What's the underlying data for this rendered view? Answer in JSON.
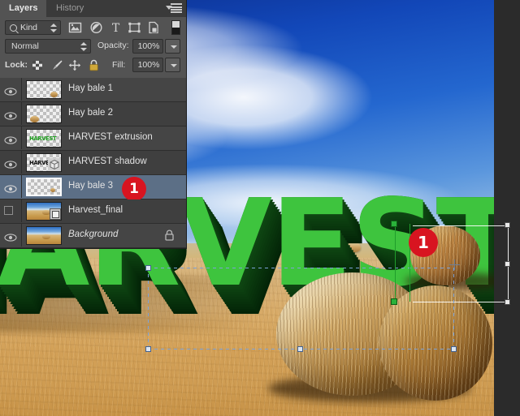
{
  "app": {
    "name": "Adobe Photoshop",
    "accent_red": "#d81420",
    "panel_bg": "#535353",
    "selected_row_bg": "#5c6f86",
    "text_green": "#3ec43e",
    "extrusion_green": "#0c3d10"
  },
  "panel": {
    "tabs": [
      {
        "label": "Layers",
        "active": true
      },
      {
        "label": "History",
        "active": false
      }
    ],
    "menu_icon": "panel-menu-icon",
    "filter": {
      "kind_label": "Kind",
      "search_icon": "search-icon",
      "icons": [
        {
          "name": "pixel-layer-filter-icon",
          "title": "Pixel layers"
        },
        {
          "name": "adjustment-layer-filter-icon",
          "title": "Adjustment layers"
        },
        {
          "name": "type-layer-filter-icon",
          "title": "Type layers"
        },
        {
          "name": "shape-layer-filter-icon",
          "title": "Shape layers"
        },
        {
          "name": "smart-object-filter-icon",
          "title": "Smart objects"
        }
      ],
      "toggle_icon": "filter-toggle-swatch"
    },
    "blend": {
      "mode": "Normal",
      "opacity_label": "Opacity:",
      "opacity_value": "100%",
      "opacity_dropdown_icon": "chevron-down-icon"
    },
    "lock": {
      "label": "Lock:",
      "icons": [
        {
          "name": "lock-transparency-icon",
          "title": "Lock transparent pixels"
        },
        {
          "name": "lock-image-pixels-icon",
          "title": "Lock image pixels"
        },
        {
          "name": "lock-position-icon",
          "title": "Lock position"
        },
        {
          "name": "lock-all-icon",
          "title": "Lock all"
        }
      ],
      "fill_label": "Fill:",
      "fill_value": "100%",
      "fill_dropdown_icon": "chevron-down-icon"
    },
    "layers": [
      {
        "name": "Hay bale 1",
        "visible": true,
        "selected": false,
        "italic": false,
        "locked": false,
        "thumb": "transparent-bale-small"
      },
      {
        "name": "Hay bale 2",
        "visible": true,
        "selected": false,
        "italic": false,
        "locked": false,
        "thumb": "transparent-bale-left"
      },
      {
        "name": "HARVEST extrusion",
        "visible": true,
        "selected": false,
        "italic": false,
        "locked": false,
        "thumb": "transparent-harvest-green"
      },
      {
        "name": "HARVEST shadow",
        "visible": true,
        "selected": false,
        "italic": false,
        "locked": false,
        "thumb": "transparent-harvest-dark-3d"
      },
      {
        "name": "Hay bale 3",
        "visible": true,
        "selected": true,
        "italic": false,
        "locked": false,
        "thumb": "transparent-bale-tiny"
      },
      {
        "name": "Harvest_final",
        "visible": false,
        "selected": false,
        "italic": false,
        "locked": false,
        "thumb": "photo-smart-object"
      },
      {
        "name": "Background",
        "visible": true,
        "selected": false,
        "italic": true,
        "locked": true,
        "thumb": "photo-field"
      }
    ]
  },
  "annotations": {
    "badges": [
      {
        "label": "1",
        "target": "hay-bale-3-layer-row"
      },
      {
        "label": "1",
        "target": "hay-bale-3-on-canvas"
      }
    ]
  },
  "canvas": {
    "document_text": "HARVEST",
    "transform_active": true,
    "transform_handles": 8
  }
}
